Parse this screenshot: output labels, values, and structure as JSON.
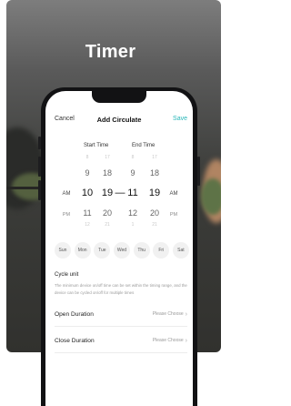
{
  "promo": {
    "title": "Timer"
  },
  "nav": {
    "cancel": "Cancel",
    "title": "Add Circulate",
    "save": "Save"
  },
  "picker": {
    "start_label": "Start Time",
    "end_label": "End Time",
    "start_hour": {
      "faint_top": "8",
      "near_top": "9",
      "selected": "10",
      "near_bottom": "11",
      "faint_bottom": "12"
    },
    "start_min": {
      "faint_top": "17",
      "near_top": "18",
      "selected": "19",
      "near_bottom": "20",
      "faint_bottom": "21"
    },
    "end_hour": {
      "faint_top": "8",
      "near_top": "9",
      "selected": "11",
      "near_bottom": "12",
      "faint_bottom": "1"
    },
    "end_min": {
      "faint_top": "17",
      "near_top": "18",
      "selected": "19",
      "near_bottom": "20",
      "faint_bottom": "21"
    },
    "separator": "—",
    "start_ampm": {
      "selected": "AM",
      "other": "PM"
    },
    "end_ampm": {
      "selected": "AM",
      "other": "PM"
    }
  },
  "weekdays": [
    "Sun",
    "Mon",
    "Tue",
    "Wed",
    "Thu",
    "Fri",
    "Sat"
  ],
  "cycle": {
    "title": "Cycle unit",
    "description": "The minimum device on/off time can be set within the timing range, and the device can be cycled on/off for multiple times"
  },
  "open_duration": {
    "label": "Open Duration",
    "value": "Please Choose"
  },
  "close_duration": {
    "label": "Close Duration",
    "value": "Please Choose"
  },
  "icons": {
    "chevron": "chevron-right-icon"
  }
}
